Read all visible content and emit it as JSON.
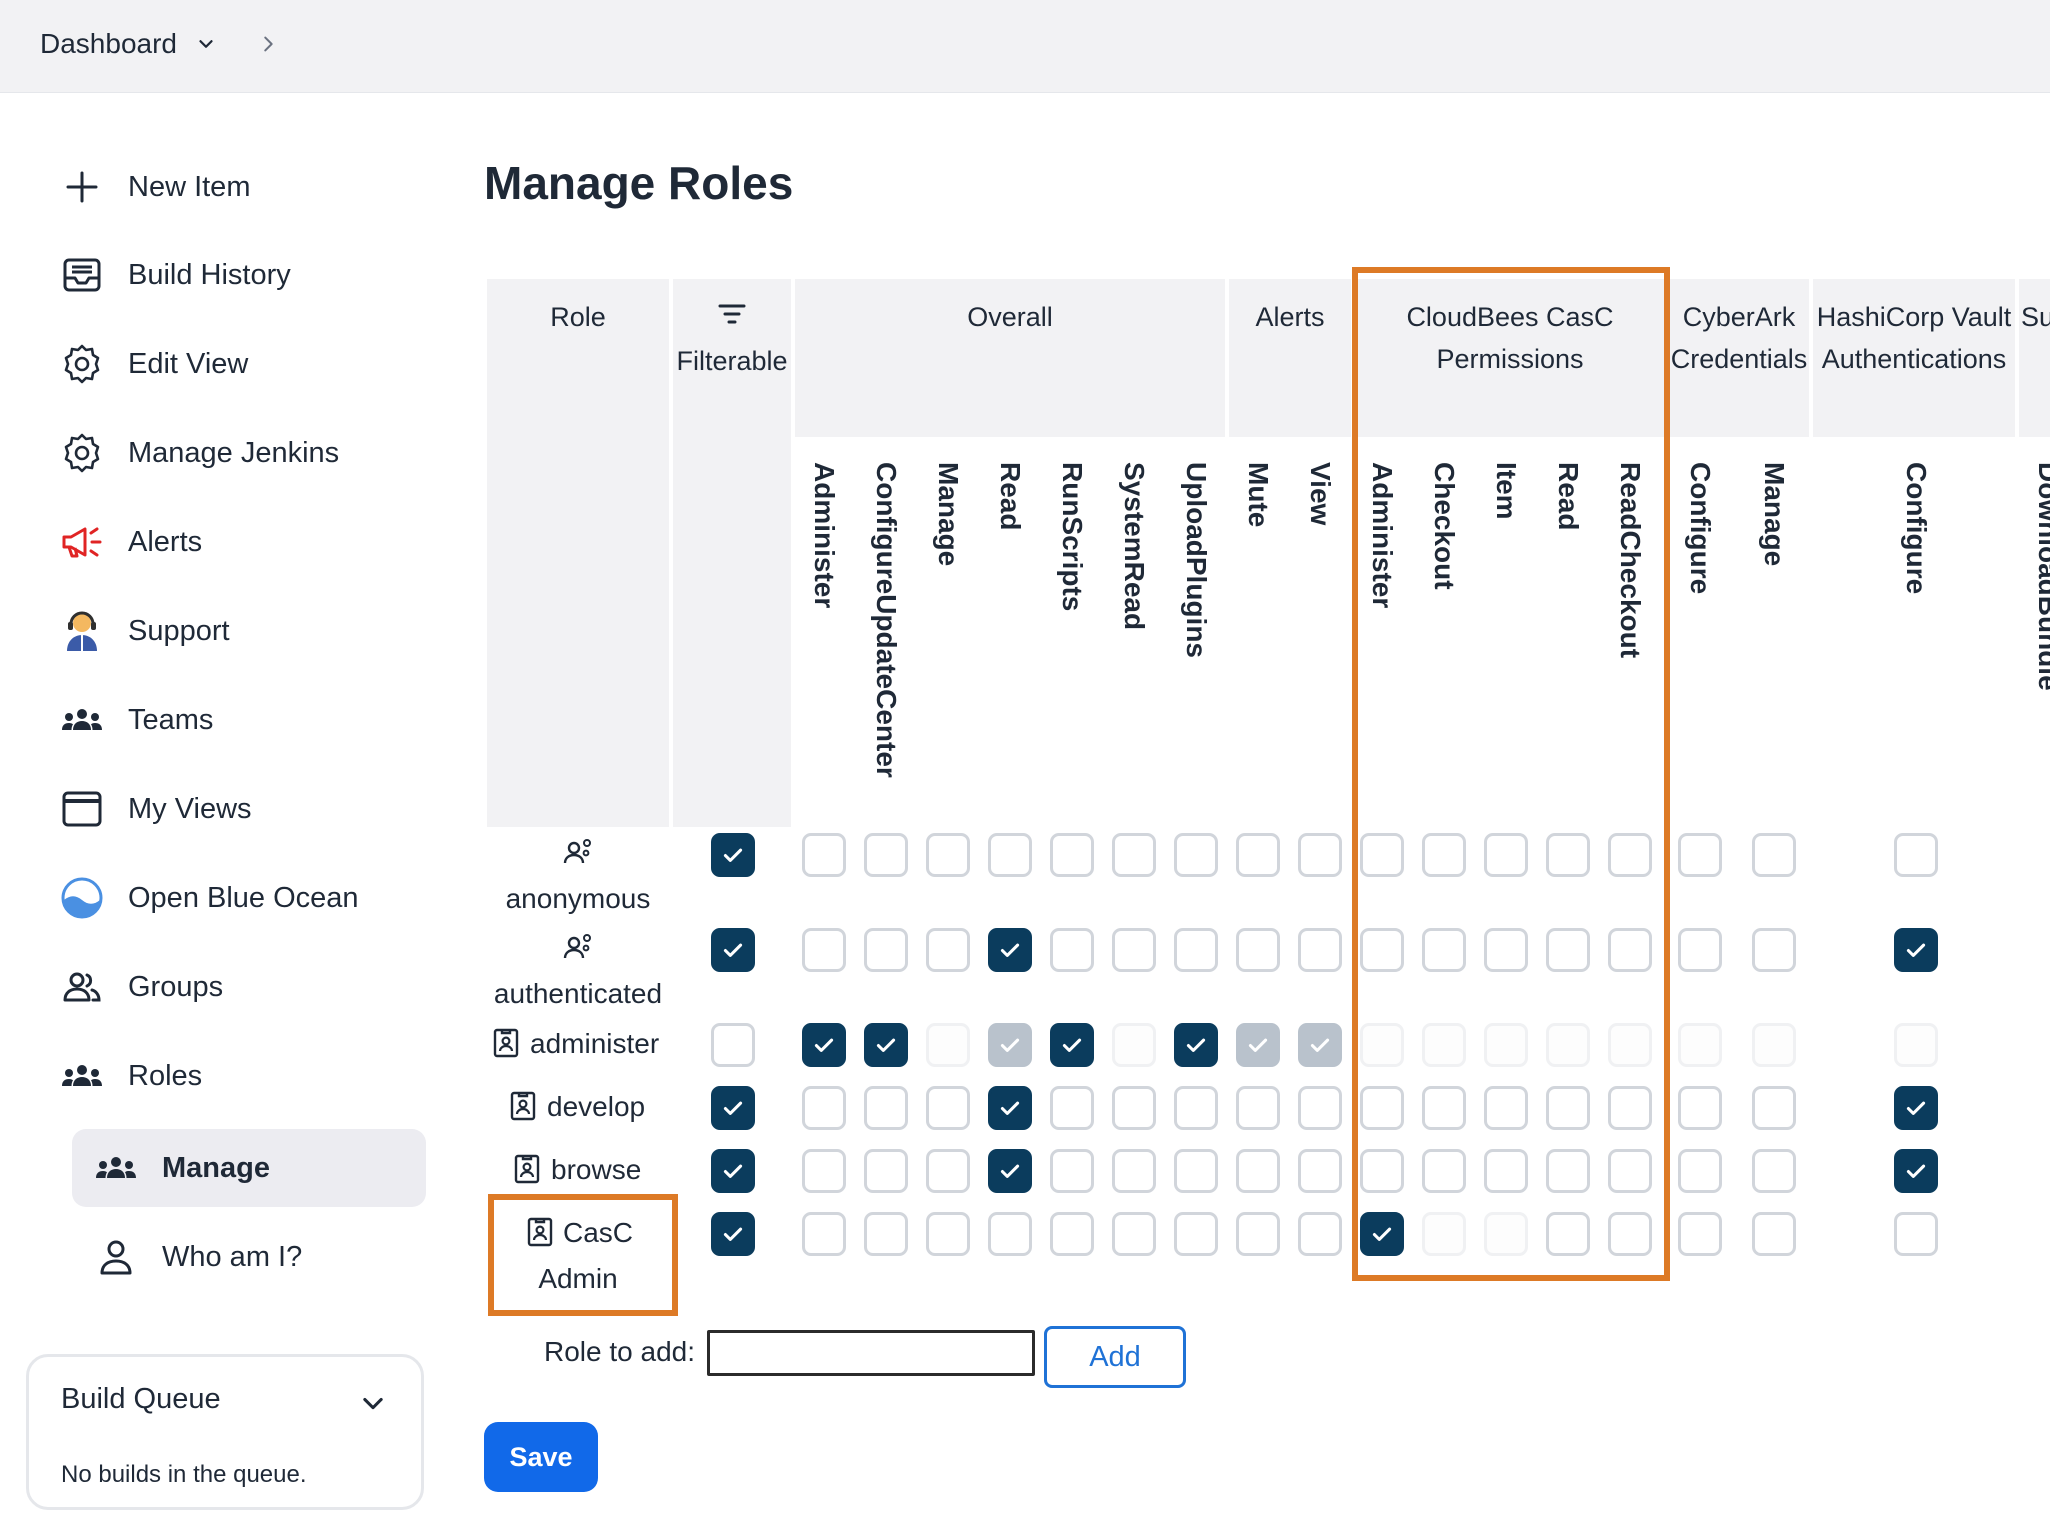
{
  "breadcrumb": {
    "label": "Dashboard"
  },
  "sidebar": {
    "items": [
      {
        "label": "New Item",
        "icon": "plus-icon"
      },
      {
        "label": "Build History",
        "icon": "inbox-icon"
      },
      {
        "label": "Edit View",
        "icon": "gear-icon"
      },
      {
        "label": "Manage Jenkins",
        "icon": "gear-icon"
      },
      {
        "label": "Alerts",
        "icon": "megaphone-icon"
      },
      {
        "label": "Support",
        "icon": "support-agent-icon"
      },
      {
        "label": "Teams",
        "icon": "people-group-icon"
      },
      {
        "label": "My Views",
        "icon": "window-icon"
      },
      {
        "label": "Open Blue Ocean",
        "icon": "blue-ocean-icon"
      },
      {
        "label": "Groups",
        "icon": "people-icon"
      },
      {
        "label": "Roles",
        "icon": "people-group-icon"
      }
    ],
    "subitems": [
      {
        "label": "Manage",
        "icon": "people-group-icon",
        "active": true
      },
      {
        "label": "Who am I?",
        "icon": "person-icon"
      }
    ]
  },
  "build_queue": {
    "title": "Build Queue",
    "empty_text": "No builds in the queue."
  },
  "page_title": "Manage Roles",
  "table": {
    "role_header": "Role",
    "filterable_header": "Filterable",
    "groups": [
      {
        "title": "Overall",
        "perms": [
          "Administer",
          "ConfigureUpdateCenter",
          "Manage",
          "Read",
          "RunScripts",
          "SystemRead",
          "UploadPlugins"
        ]
      },
      {
        "title": "Alerts",
        "perms": [
          "Mute",
          "View"
        ]
      },
      {
        "title": "CloudBees CasC Permissions",
        "perms": [
          "Administer",
          "Checkout",
          "Item",
          "Read",
          "ReadCheckout"
        ]
      },
      {
        "title": "CyberArk Credentials",
        "perms": [
          "Configure",
          "Manage"
        ]
      },
      {
        "title": "HashiCorp Vault Authentications",
        "perms": [
          "Configure"
        ]
      },
      {
        "title": "Su",
        "perms": [
          "DownloadBundle"
        ]
      }
    ],
    "rows": [
      {
        "name": "anonymous",
        "icon": "user-gear-icon",
        "filterable": "c",
        "perms": [
          "u",
          "u",
          "u",
          "u",
          "u",
          "u",
          "u",
          "u",
          "u",
          "u",
          "u",
          "u",
          "u",
          "u",
          "u",
          "u",
          "u"
        ]
      },
      {
        "name": "authenticated",
        "icon": "user-gear-icon",
        "filterable": "c",
        "perms": [
          "u",
          "u",
          "u",
          "c",
          "u",
          "u",
          "u",
          "u",
          "u",
          "u",
          "u",
          "u",
          "u",
          "u",
          "u",
          "u",
          "c"
        ]
      },
      {
        "name": "administer",
        "icon": "id-badge-icon",
        "filterable": "u",
        "perms": [
          "c",
          "c",
          "d",
          "g",
          "c",
          "d",
          "c",
          "g",
          "g",
          "d",
          "d",
          "d",
          "d",
          "d",
          "d",
          "d",
          "d"
        ]
      },
      {
        "name": "develop",
        "icon": "id-badge-icon",
        "filterable": "c",
        "perms": [
          "u",
          "u",
          "u",
          "c",
          "u",
          "u",
          "u",
          "u",
          "u",
          "u",
          "u",
          "u",
          "u",
          "u",
          "u",
          "u",
          "c"
        ]
      },
      {
        "name": "browse",
        "icon": "id-badge-icon",
        "filterable": "c",
        "perms": [
          "u",
          "u",
          "u",
          "c",
          "u",
          "u",
          "u",
          "u",
          "u",
          "u",
          "u",
          "u",
          "u",
          "u",
          "u",
          "u",
          "c"
        ]
      },
      {
        "name": "CasC",
        "name2": "Admin",
        "icon": "id-badge-icon",
        "filterable": "c",
        "perms": [
          "u",
          "u",
          "u",
          "u",
          "u",
          "u",
          "u",
          "u",
          "u",
          "c",
          "d",
          "d",
          "u",
          "u",
          "u",
          "u",
          "u"
        ]
      }
    ]
  },
  "add_role": {
    "label": "Role to add:",
    "value": "",
    "button": "Add"
  },
  "save_label": "Save",
  "colors": {
    "checked": "#0b3c5d",
    "highlight": "#dd7a26",
    "primary": "#1169e9",
    "add_button": "#1f72d6"
  }
}
